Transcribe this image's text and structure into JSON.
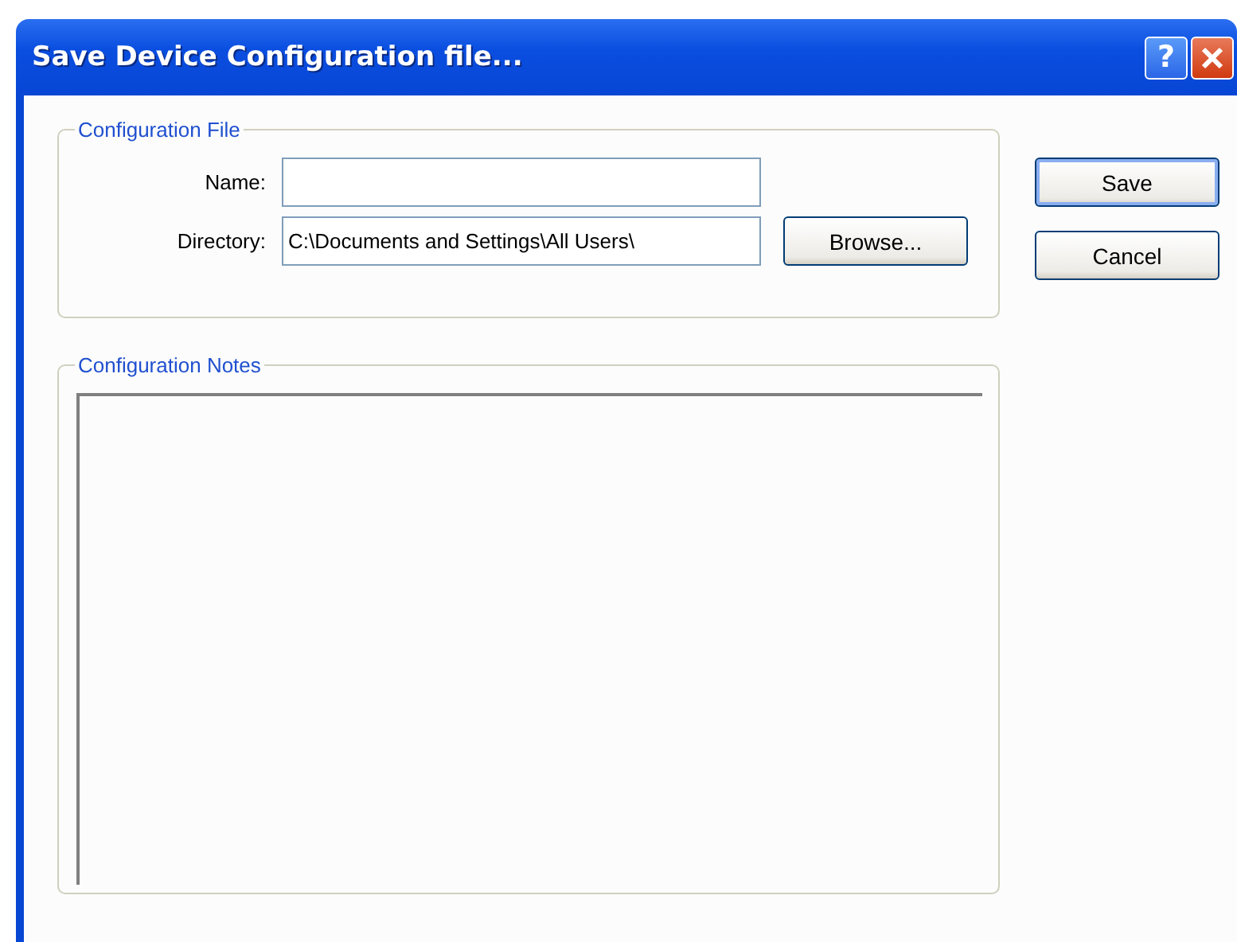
{
  "window": {
    "title": "Save Device Configuration file..."
  },
  "title_buttons": [
    {
      "kind": "help",
      "label": "?"
    },
    {
      "kind": "close"
    }
  ],
  "configuration_file": {
    "legend": "Configuration File",
    "name_label": "Name:",
    "directory_label": "Directory:",
    "directory_value": "C:\\Documents and Settings\\All Users\\",
    "browse": "Browse..."
  },
  "configuration_notes": {
    "legend": "Configuration Notes"
  },
  "buttons": [
    {
      "label": "Save",
      "default": true
    },
    {
      "label": "Cancel",
      "default": false
    }
  ]
}
